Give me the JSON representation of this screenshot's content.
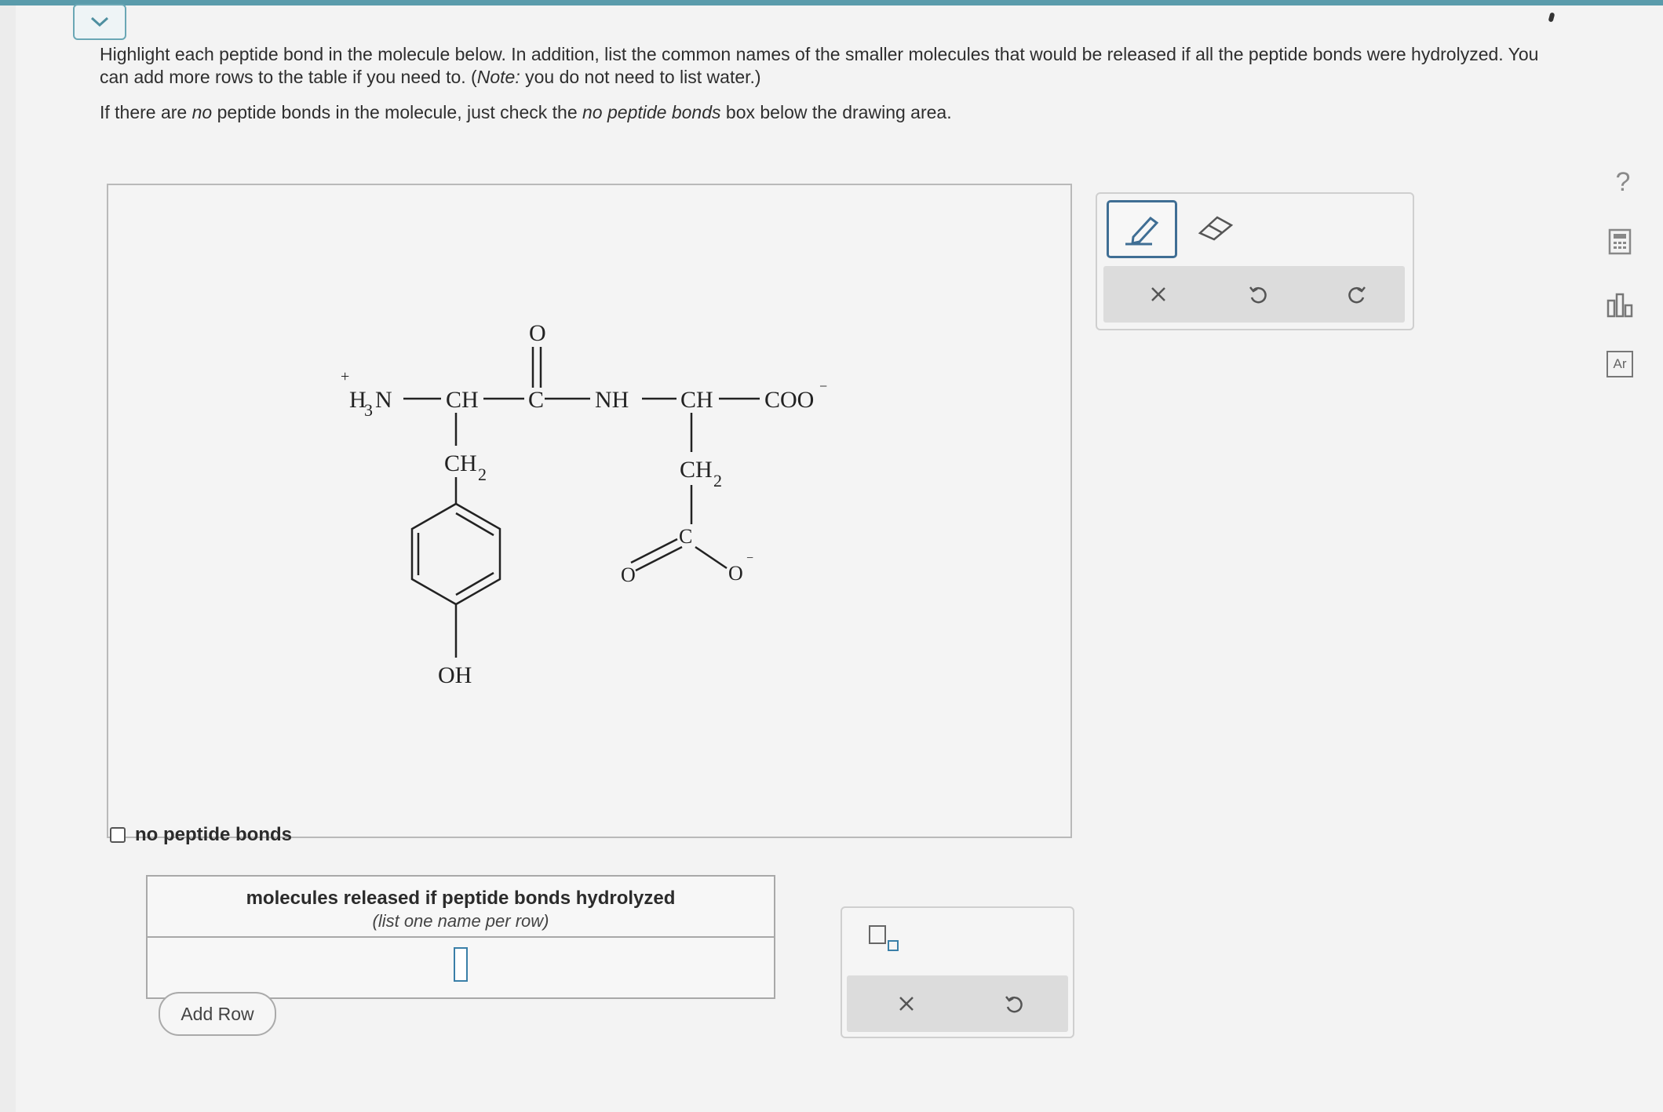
{
  "header": {
    "collapse_icon": "chevron-down-icon"
  },
  "prompt": {
    "line1_a": "Highlight each peptide bond in the molecule below. In addition, list the common names of the smaller molecules that would be released if all the peptide bonds were hydrolyzed. You can add more rows to the table if you need to. (",
    "line1_note": "Note:",
    "line1_b": " you do not need to list water.)",
    "line2_a": "If there are ",
    "line2_no": "no",
    "line2_b": " peptide bonds in the molecule, just check the ",
    "line2_nopb": "no peptide bonds",
    "line2_c": " box below the drawing area."
  },
  "molecule": {
    "charge_plus": "+",
    "amine_H": "H",
    "amine_sub": "3",
    "amine_N": "N",
    "ch_1": "CH",
    "carbonyl_C": "C",
    "carbonyl_O": "O",
    "nh": "NH",
    "ch_2": "CH",
    "coo": "COO",
    "charge_minus": "−",
    "ch2_left": "CH",
    "ch2_left_sub": "2",
    "ch2_right": "CH",
    "ch2_right_sub": "2",
    "oh": "OH",
    "side_C": "C",
    "side_O_double": "O",
    "side_O_single": "O",
    "side_minus": "−"
  },
  "no_peptide_bonds_label": "no peptide bonds",
  "tools": {
    "pencil": "pencil-icon",
    "eraser": "eraser-icon",
    "clear": "close-icon",
    "undo": "undo-icon",
    "redo": "redo-icon"
  },
  "sidebar": {
    "help": "?",
    "calculator": "calculator-icon",
    "chart": "chart-icon",
    "periodic": "Ar"
  },
  "table": {
    "header_bold": "molecules released if peptide bonds hydrolyzed",
    "header_italic": "(list one name per row)",
    "rows": [
      ""
    ]
  },
  "add_row_label": "Add Row",
  "table_tools": {
    "subscript": "subscript-icon",
    "clear": "close-icon",
    "undo": "undo-icon"
  }
}
